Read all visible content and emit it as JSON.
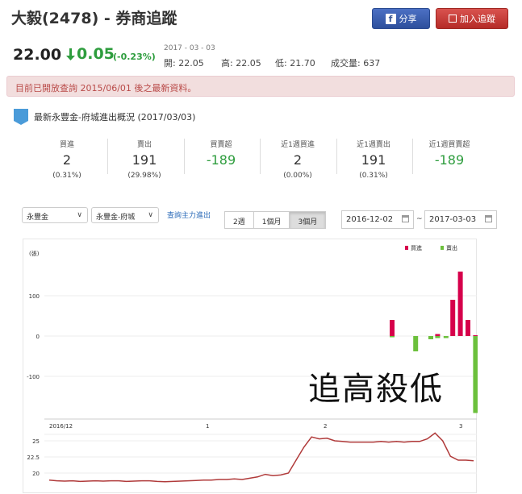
{
  "header": {
    "title": "大毅(2478) - 券商追蹤",
    "share_label": "分享",
    "favorite_label": "加入追蹤"
  },
  "quote": {
    "price": "22.00",
    "change": "0.05",
    "change_pct": "(-0.23%)",
    "date": "2017 - 03 - 03",
    "open": "開: 22.05",
    "high": "高: 22.05",
    "low": "低: 21.70",
    "volume": "成交量: 637"
  },
  "alert": "目前已開放查詢 2015/06/01 後之最新資料。",
  "section": {
    "icon": "broker-icon",
    "title": "最新永豐金-府城進出概況 (2017/03/03)"
  },
  "stats": [
    {
      "label": "買進",
      "value": "2",
      "pct": "(0.31%)"
    },
    {
      "label": "賣出",
      "value": "191",
      "pct": "(29.98%)"
    },
    {
      "label": "買賣超",
      "value": "-189",
      "pct": ""
    },
    {
      "label": "近1週買進",
      "value": "2",
      "pct": "(0.00%)"
    },
    {
      "label": "近1週賣出",
      "value": "191",
      "pct": "(0.31%)"
    },
    {
      "label": "近1週買賣超",
      "value": "-189",
      "pct": ""
    }
  ],
  "controls": {
    "broker": "永豐金",
    "branch": "永豐金-府城",
    "query_link": "查詢主力進出",
    "ranges": [
      "2週",
      "1個月",
      "3個月"
    ],
    "active_range": "3個月",
    "date_from": "2016-12-02",
    "date_sep": "~",
    "date_to": "2017-03-03"
  },
  "chart_data": [
    {
      "type": "bar",
      "ylabel": "(張)",
      "ylim": [
        -200,
        200
      ],
      "yticks": [
        "100",
        "0",
        "-100"
      ],
      "xticks": [
        "2016/12",
        "1",
        "2",
        "3"
      ],
      "legend": [
        "買進",
        "賣出"
      ],
      "colors": {
        "buy": "#d6004b",
        "sell": "#6cc03c"
      },
      "series": [
        {
          "name": "買進",
          "values": [
            0,
            0,
            0,
            0,
            0,
            0,
            0,
            0,
            0,
            0,
            40,
            0,
            0,
            0,
            0,
            0,
            5,
            0,
            90,
            160,
            40,
            2
          ]
        },
        {
          "name": "賣出",
          "values": [
            0,
            0,
            0,
            0,
            0,
            0,
            0,
            0,
            0,
            0,
            -3,
            0,
            0,
            -38,
            0,
            -8,
            -5,
            -5,
            0,
            0,
            0,
            -191
          ]
        }
      ]
    },
    {
      "type": "line",
      "yticks": [
        "25",
        "22.5",
        "20"
      ],
      "ylim": [
        19,
        27
      ],
      "color": "#b03a3a",
      "values": [
        18.9,
        18.8,
        18.75,
        18.8,
        18.7,
        18.75,
        18.8,
        18.75,
        18.8,
        18.8,
        18.7,
        18.75,
        18.8,
        18.8,
        18.7,
        18.65,
        18.7,
        18.75,
        18.8,
        18.85,
        18.9,
        18.9,
        19.0,
        19.0,
        19.1,
        19.0,
        19.2,
        19.4,
        19.8,
        19.6,
        19.7,
        20.0,
        22.0,
        24.0,
        25.6,
        25.3,
        25.4,
        25.0,
        24.9,
        24.8,
        24.8,
        24.8,
        24.8,
        24.9,
        24.8,
        24.9,
        24.8,
        24.9,
        24.9,
        25.3,
        26.2,
        25.0,
        22.6,
        22.0,
        22.0,
        21.9
      ]
    }
  ],
  "overlay_text": "追高殺低"
}
